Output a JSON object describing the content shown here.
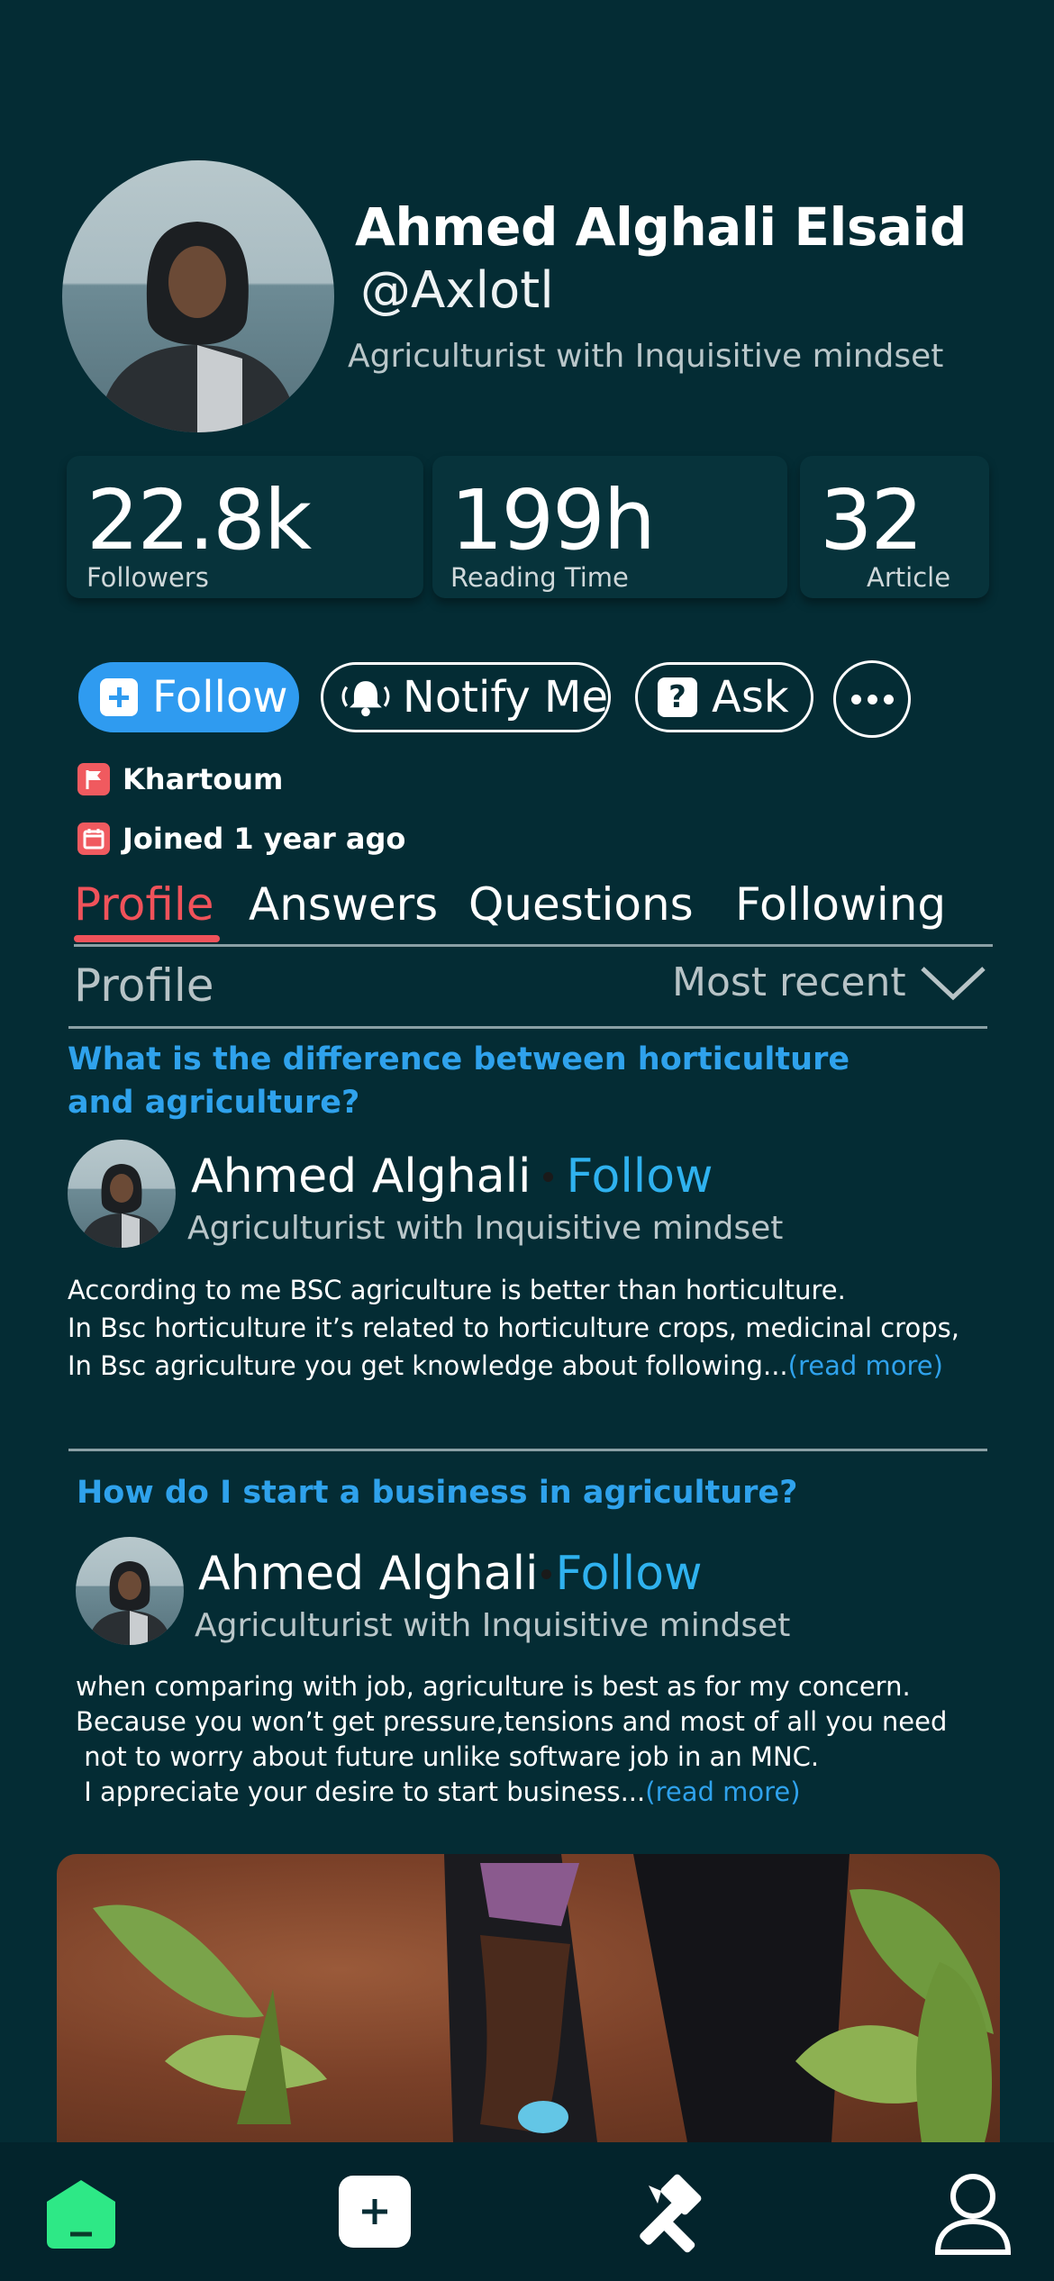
{
  "profile": {
    "name": "Ahmed Alghali Elsaid",
    "handle": "@Axlotl",
    "bio": "Agriculturist with Inquisitive mindset"
  },
  "stats": [
    {
      "value": "22.8k",
      "label": "Followers"
    },
    {
      "value": "199h",
      "label": "Reading Time"
    },
    {
      "value": "32",
      "label": "Article"
    }
  ],
  "actions": {
    "follow": "Follow",
    "notify": "Notify Me",
    "ask": "Ask"
  },
  "meta": {
    "location": "Khartoum",
    "joined": "Joined 1 year ago"
  },
  "tabs": [
    "Profile",
    "Answers",
    "Questions",
    "Following"
  ],
  "section": {
    "title": "Profile",
    "sort": "Most recent"
  },
  "posts": [
    {
      "question_line1": "What is the difference between horticulture",
      "question_line2": "and agriculture?",
      "author": "Ahmed Alghali",
      "follow": "Follow",
      "bio": "Agriculturist with Inquisitive mindset",
      "text": "According to me BSC agriculture is better than horticulture.\nIn Bsc horticulture it’s related to horticulture crops, medicinal crops,\nIn Bsc agriculture you get knowledge about following...",
      "read_more": "(read more)"
    },
    {
      "question_line1": "How do I start a business in agriculture?",
      "author": "Ahmed Alghali",
      "follow": "Follow",
      "bio": "Agriculturist with Inquisitive mindset",
      "text": "when comparing with job, agriculture is best as for my concern.\nBecause you won’t get pressure,tensions and most of all you need\n not to worry about future unlike software job in an MNC.\n I appreciate your desire to start business...",
      "read_more": "(read more)"
    }
  ],
  "colors": {
    "background": "#042c34",
    "accent_blue": "#2f9bf0",
    "accent_red": "#f0525a",
    "home_green": "#2ee886"
  },
  "icons": {
    "nav": [
      "home-icon",
      "add-icon",
      "tools-icon",
      "user-icon"
    ]
  }
}
